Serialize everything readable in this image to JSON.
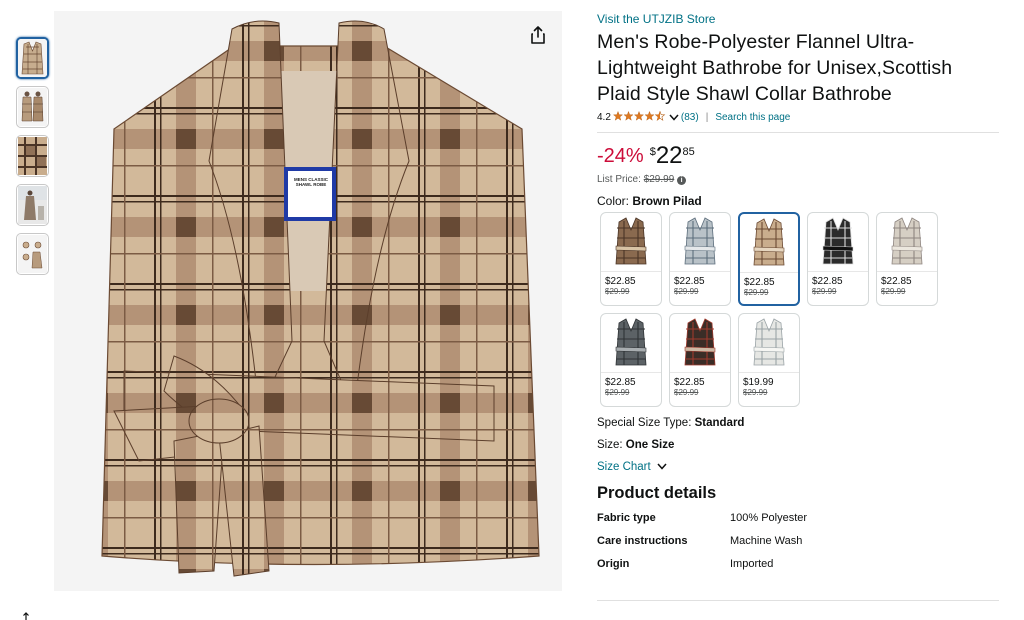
{
  "store": {
    "link_label": "Visit the UTJZIB Store"
  },
  "product": {
    "title": "Men's Robe-Polyester Flannel Ultra-Lightweight Bathrobe for Unisex,Scottish Plaid Style Shawl Collar Bathrobe",
    "rating_value": "4.2",
    "rating_stars": 4.2,
    "review_count": "(83)",
    "search_page_label": "Search this page",
    "tag_text": "MENS CLASSIC SHAWL ROBE"
  },
  "pricing": {
    "discount": "-24%",
    "currency": "$",
    "whole": "22",
    "fraction": "85",
    "list_price_label": "List Price:",
    "list_price": "$29.99"
  },
  "color": {
    "label": "Color:",
    "selected": "Brown Pilad",
    "options": [
      {
        "icon": "brown-dark-plaid-robe",
        "colors": [
          "#8a6a4f",
          "#4a3426",
          "#d8c3a5"
        ],
        "price": "$22.85",
        "list": "$29.99"
      },
      {
        "icon": "grey-blue-plaid-robe",
        "colors": [
          "#b9c2c8",
          "#5d6e7c",
          "#e5e8ea"
        ],
        "price": "$22.85",
        "list": "$29.99"
      },
      {
        "icon": "brown-plaid-robe",
        "colors": [
          "#c9ad8d",
          "#6b4a33",
          "#e6d6c0"
        ],
        "price": "$22.85",
        "list": "$29.99"
      },
      {
        "icon": "black-white-plaid-robe",
        "colors": [
          "#2b2b2b",
          "#dcdcdc",
          "#111111"
        ],
        "price": "$22.85",
        "list": "$29.99"
      },
      {
        "icon": "beige-grey-plaid-robe",
        "colors": [
          "#d6cfc4",
          "#8e8580",
          "#ece7de"
        ],
        "price": "$22.85",
        "list": "$29.99"
      },
      {
        "icon": "charcoal-plaid-robe",
        "colors": [
          "#5c6266",
          "#2f3336",
          "#a8adb0"
        ],
        "price": "$22.85",
        "list": "$29.99"
      },
      {
        "icon": "red-black-plaid-robe",
        "colors": [
          "#3a2d27",
          "#9e3a2e",
          "#cdb9a5"
        ],
        "price": "$22.85",
        "list": "$29.99"
      },
      {
        "icon": "light-grey-plaid-robe",
        "colors": [
          "#e6e7e4",
          "#9aa3a6",
          "#f6f6f3"
        ],
        "price": "$19.99",
        "list": "$29.99"
      }
    ]
  },
  "special_size": {
    "label": "Special Size Type:",
    "value": "Standard"
  },
  "size": {
    "label": "Size:",
    "value": "One Size"
  },
  "size_chart_label": "Size Chart",
  "details": {
    "title": "Product details",
    "rows": [
      {
        "key": "Fabric type",
        "value": "100% Polyester"
      },
      {
        "key": "Care instructions",
        "value": "Machine Wash"
      },
      {
        "key": "Origin",
        "value": "Imported"
      }
    ]
  },
  "icons": {
    "share": "share-icon",
    "info": "info-icon",
    "chevron": "chevron-down-icon",
    "star": "star-icon"
  },
  "colors": {
    "link": "#007185",
    "discount": "#cc0c39",
    "star": "#de7921",
    "selected_border": "#2162a1"
  }
}
